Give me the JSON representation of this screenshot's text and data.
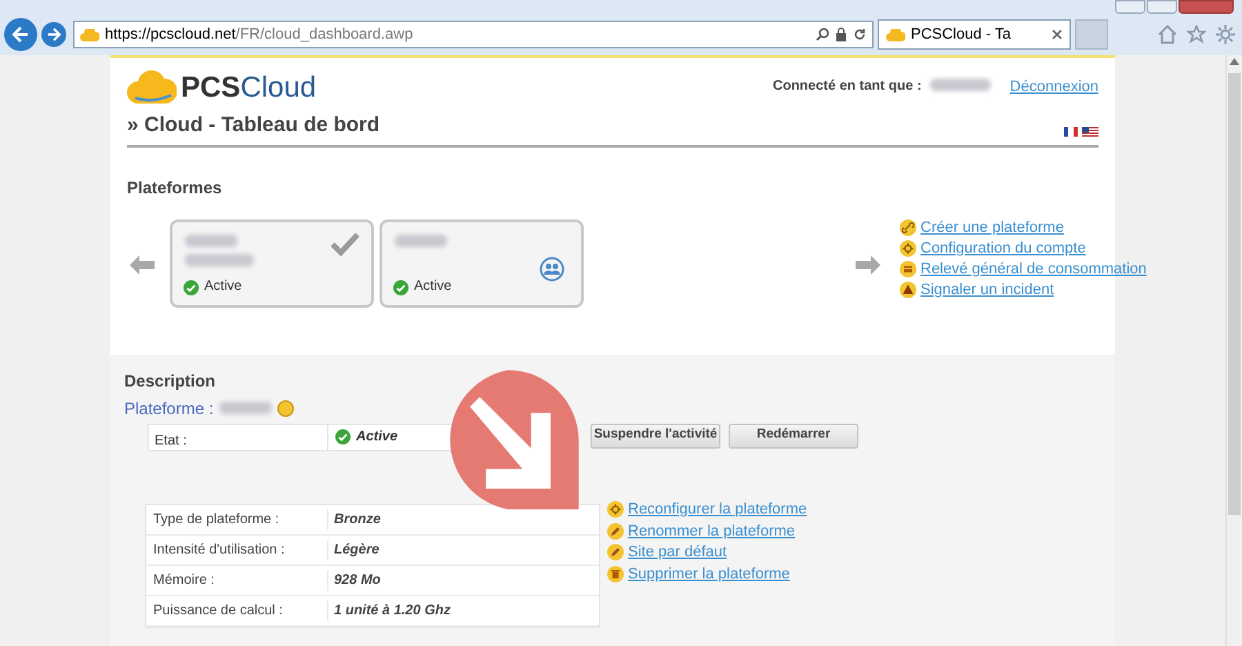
{
  "browser": {
    "url_host": "https://pcscloud.net",
    "url_path": "/FR/cloud_dashboard.awp",
    "tab_title": "PCSCloud - Ta"
  },
  "header": {
    "logo": [
      "PCS",
      "Cloud"
    ],
    "connected_label": "Connecté en tant que :",
    "logout": "Déconnexion",
    "page_title": "» Cloud - Tableau de bord"
  },
  "platforms": {
    "heading": "Plateformes",
    "cards": [
      {
        "status": "Active",
        "selected": true,
        "kind": "ip"
      },
      {
        "status": "Active",
        "selected": false,
        "kind": "shared"
      }
    ],
    "links": [
      {
        "label": "Créer une plateforme",
        "kind": "link"
      },
      {
        "label": "Configuration du compte",
        "kind": "gear"
      },
      {
        "label": "Relevé général de consommation",
        "kind": "card"
      },
      {
        "label": "Signaler un incident",
        "kind": "warning"
      }
    ]
  },
  "description": {
    "heading": "Description",
    "platform_label": "Plateforme :",
    "state": {
      "label": "Etat :",
      "value": "Active"
    },
    "buttons": [
      "Suspendre l'activité",
      "Redémarrer"
    ],
    "specs": [
      {
        "label": "Type de plateforme :",
        "value": "Bronze"
      },
      {
        "label": "Intensité d'utilisation :",
        "value": "Légère"
      },
      {
        "label": "Mémoire :",
        "value": "928 Mo"
      },
      {
        "label": "Puissance de calcul :",
        "value": "1 unité à 1.20 Ghz"
      }
    ],
    "links": [
      {
        "label": "Reconfigurer la plateforme",
        "kind": "gear"
      },
      {
        "label": "Renommer la plateforme",
        "kind": "edit"
      },
      {
        "label": "Site par défaut",
        "kind": "edit"
      },
      {
        "label": "Supprimer la plateforme",
        "kind": "trash"
      }
    ]
  }
}
